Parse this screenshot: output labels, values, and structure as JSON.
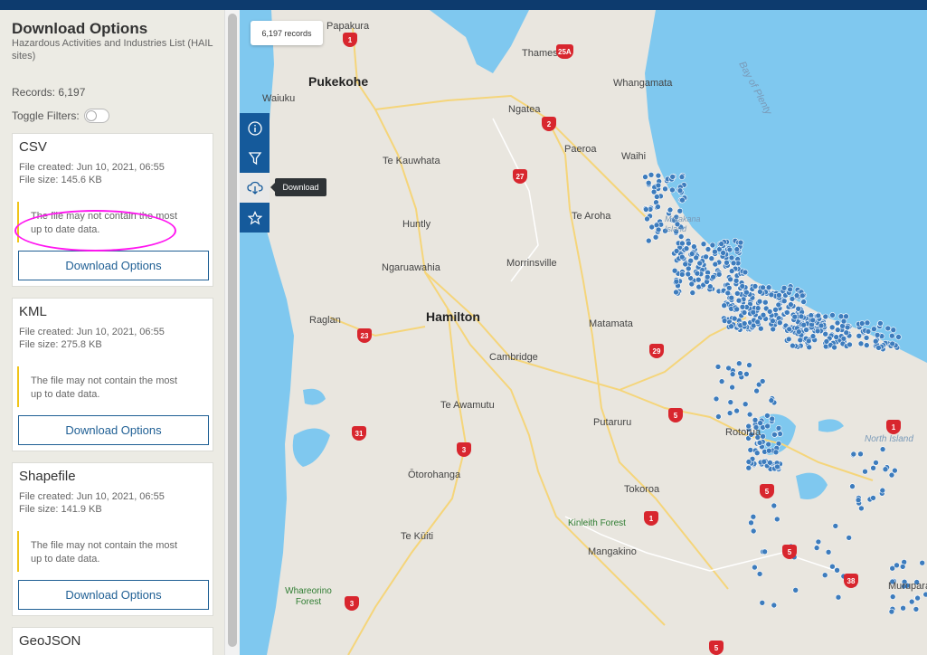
{
  "panel": {
    "title": "Download Options",
    "subtitle": "Hazardous Activities and Industries List (HAIL sites)",
    "records": "Records: 6,197",
    "toggle_label": "Toggle Filters:"
  },
  "formats": [
    {
      "name": "CSV",
      "created": "File created: Jun 10, 2021, 06:55",
      "size": "File size: 145.6 KB",
      "notice": "The file may not contain the most up to date data.",
      "button": "Download Options"
    },
    {
      "name": "KML",
      "created": "File created: Jun 10, 2021, 06:55",
      "size": "File size: 275.8 KB",
      "notice": "The file may not contain the most up to date data.",
      "button": "Download Options"
    },
    {
      "name": "Shapefile",
      "created": "File created: Jun 10, 2021, 06:55",
      "size": "File size: 141.9 KB",
      "notice": "The file may not contain the most up to date data.",
      "button": "Download Options"
    },
    {
      "name": "GeoJSON"
    }
  ],
  "map": {
    "records_badge": "6,197 records",
    "tooltip": "Download",
    "places": [
      "Papakura",
      "Pukekohe",
      "Waiuku",
      "Thames",
      "Whangamata",
      "Ngatea",
      "Paeroa",
      "Waihi",
      "Te Kauwhata",
      "Huntly",
      "Te Aroha",
      "Ngaruawahia",
      "Morrinsville",
      "Hamilton",
      "Raglan",
      "Matamata",
      "Cambridge",
      "Te Awamutu",
      "Putaruru",
      "Ōtorohanga",
      "Tokoroa",
      "Te Kūiti",
      "Mangakino",
      "Kinleith Forest",
      "Whareorino Forest",
      "Bay of Plenty",
      "Matakana Island",
      "North Island",
      "Rotorua",
      "Murupara"
    ],
    "routes": [
      "1",
      "25A",
      "2",
      "27",
      "23",
      "29",
      "5",
      "31",
      "3",
      "1",
      "5",
      "3",
      "5",
      "5",
      "38",
      "1"
    ]
  },
  "colors": {
    "accent": "#1f5f94",
    "toolbar": "#155a9b",
    "dots": "#3d7cbd",
    "sea": "#7fc8ef",
    "highlight": "#ff16f0"
  }
}
